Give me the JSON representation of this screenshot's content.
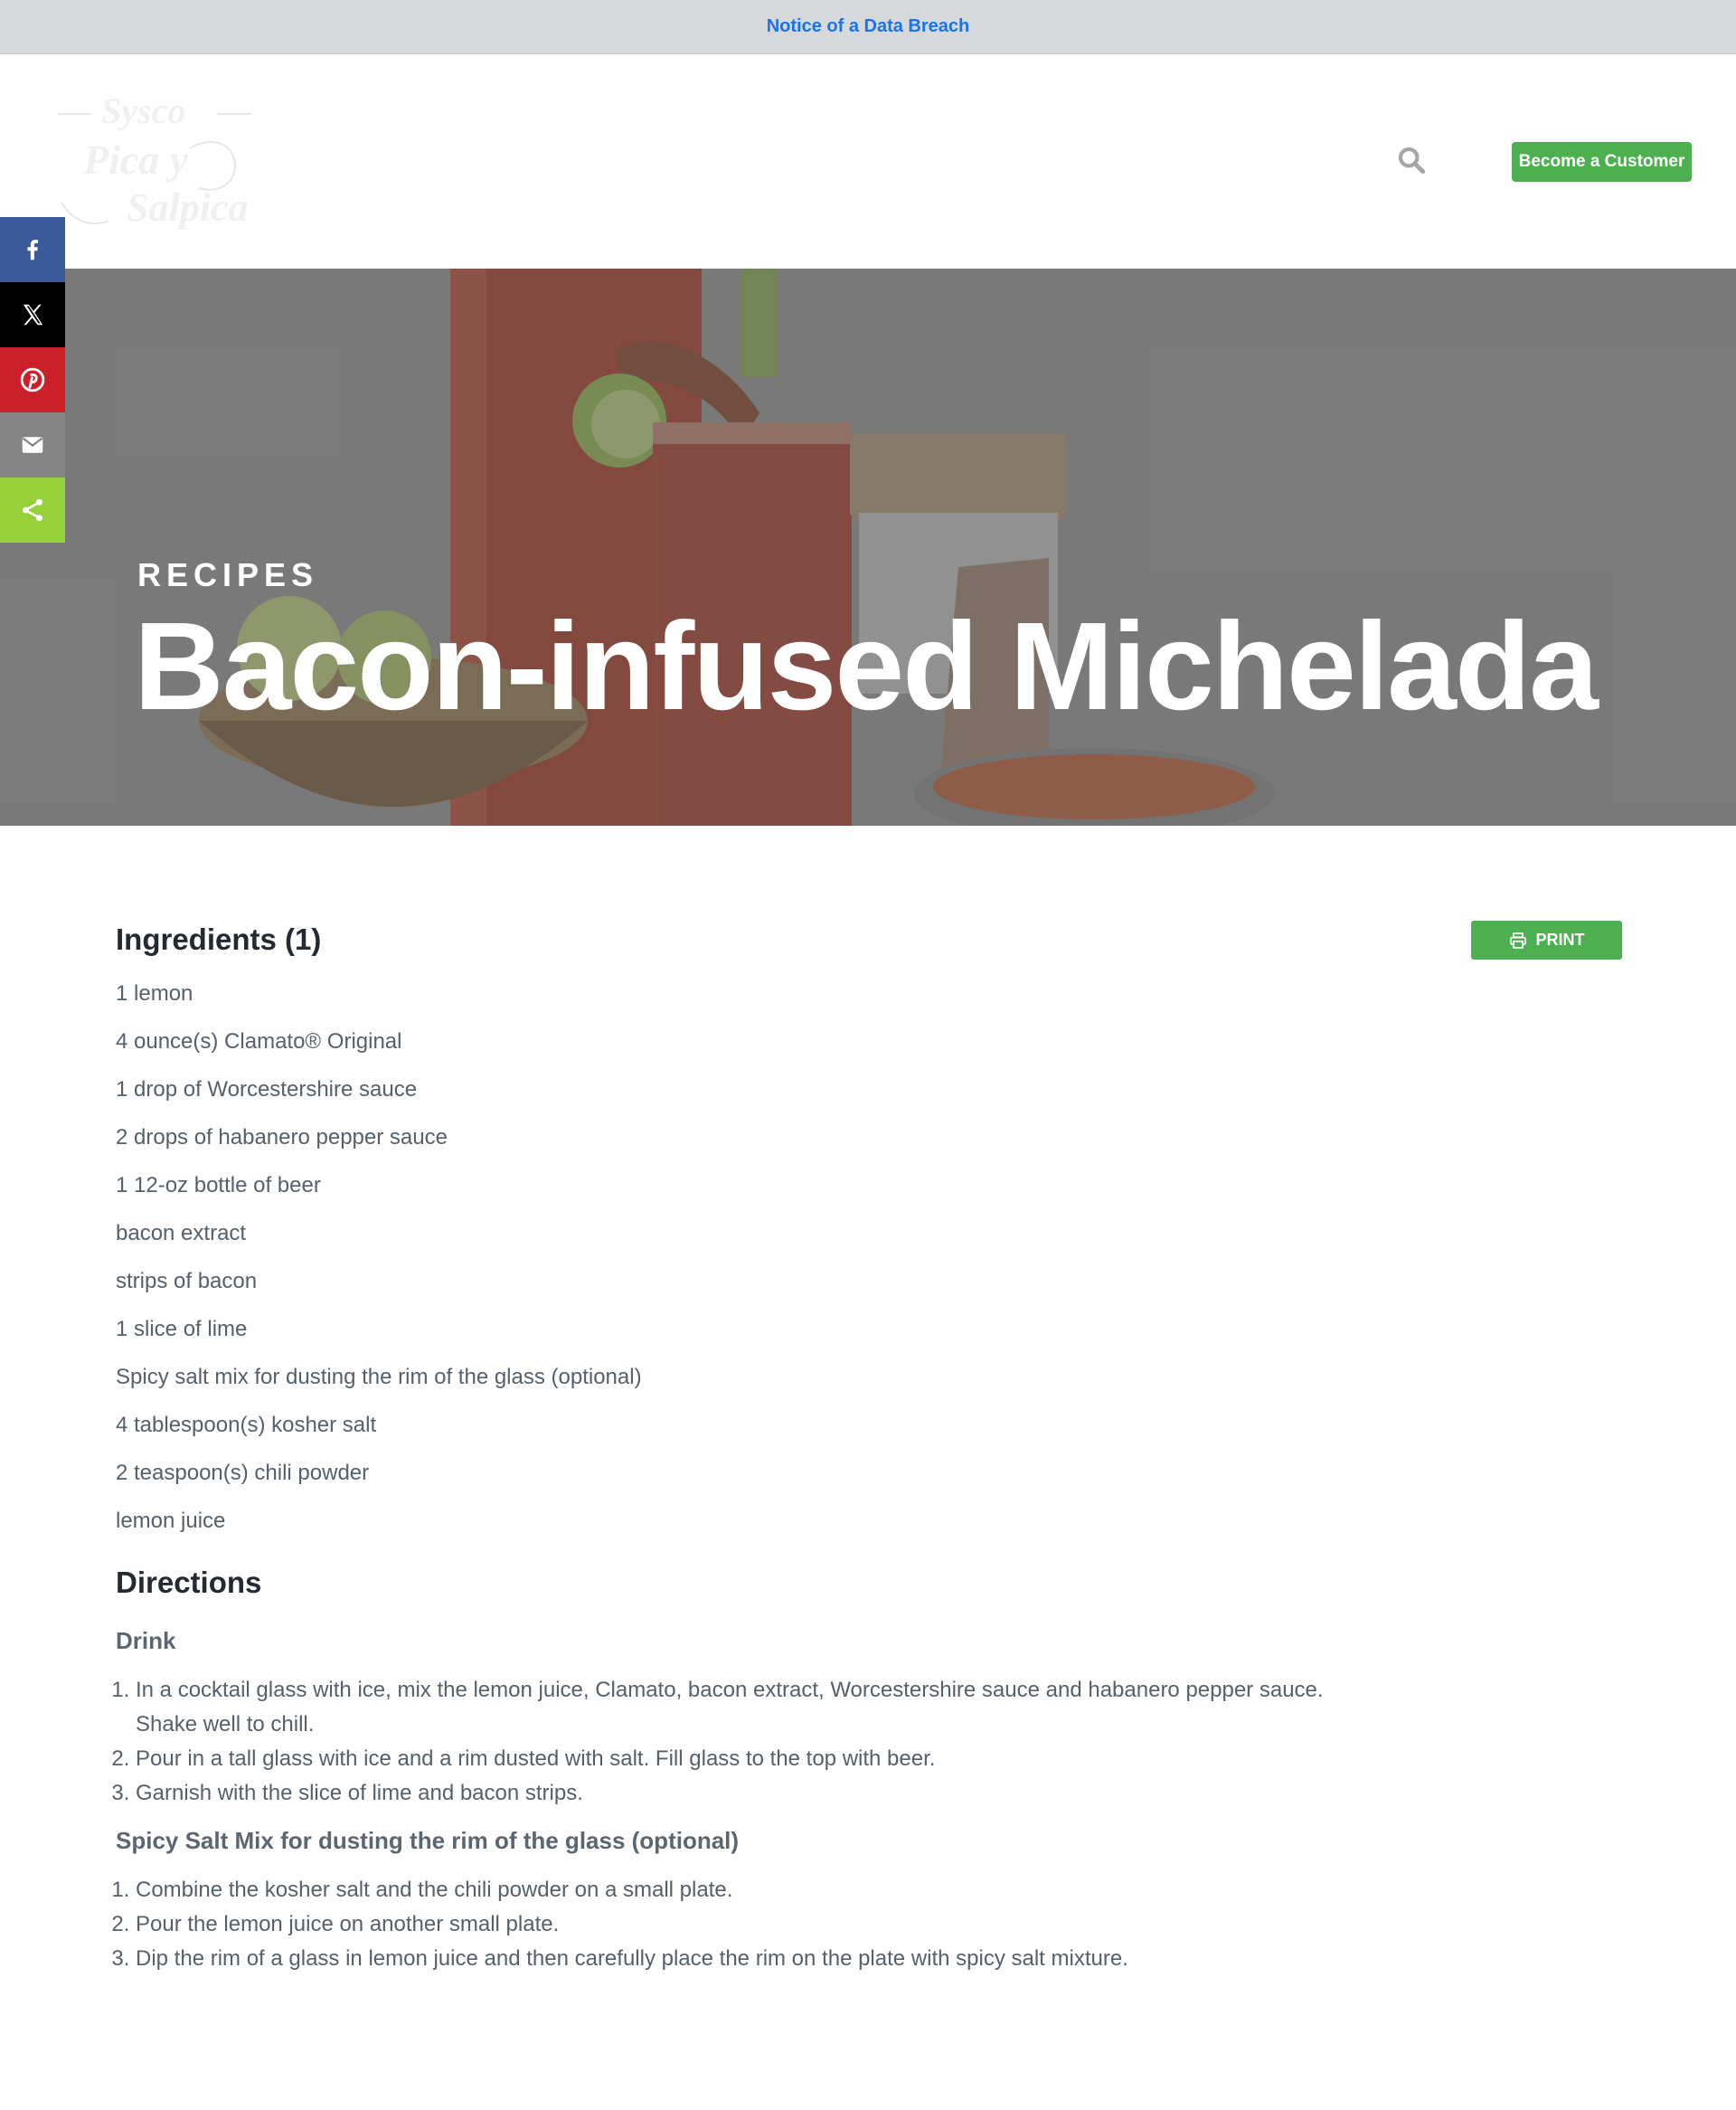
{
  "notice": {
    "link_text": "Notice of a Data Breach"
  },
  "header": {
    "logo_lines": [
      "Sysco",
      "Pica y",
      "Salpica"
    ],
    "become_customer_label": "Become a Customer"
  },
  "social": [
    "facebook-icon",
    "x-icon",
    "pinterest-icon",
    "email-icon",
    "share-icon"
  ],
  "hero": {
    "kicker": "RECIPES",
    "title": "Bacon-infused Michelada"
  },
  "colors": {
    "accent_green": "#4caf50",
    "notice_link": "#1a73e8",
    "facebook": "#3b5998",
    "x": "#000000",
    "pinterest": "#cb2027",
    "email": "#848484",
    "share": "#95d03a"
  },
  "ingredients": {
    "title": "Ingredients (1)",
    "print_label": "PRINT",
    "items": [
      "1 lemon",
      "4 ounce(s) Clamato® Original",
      "1 drop of Worcestershire sauce",
      "2 drops of habanero pepper sauce",
      "1 12-oz bottle of beer",
      "bacon extract",
      "strips of bacon",
      "1 slice of lime",
      "Spicy salt mix for dusting the rim of the glass (optional)",
      "4 tablespoon(s) kosher salt",
      "2 teaspoon(s) chili powder",
      "lemon juice"
    ]
  },
  "directions": {
    "title": "Directions",
    "sections": [
      {
        "title": "Drink",
        "steps": [
          "In a cocktail glass with ice, mix the lemon juice, Clamato, bacon extract, Worcestershire sauce and habanero pepper sauce. Shake well to chill.",
          "Pour in a tall glass with ice and a rim dusted with salt. Fill glass to the top with beer.",
          "Garnish with the slice of lime and bacon strips."
        ]
      },
      {
        "title": "Spicy Salt Mix for dusting the rim of the glass (optional)",
        "steps": [
          "Combine the kosher salt and the chili powder on a small plate.",
          "Pour the lemon juice on another small plate.",
          "Dip the rim of a glass in lemon juice and then carefully place the rim on the plate with spicy salt mixture."
        ]
      }
    ]
  }
}
